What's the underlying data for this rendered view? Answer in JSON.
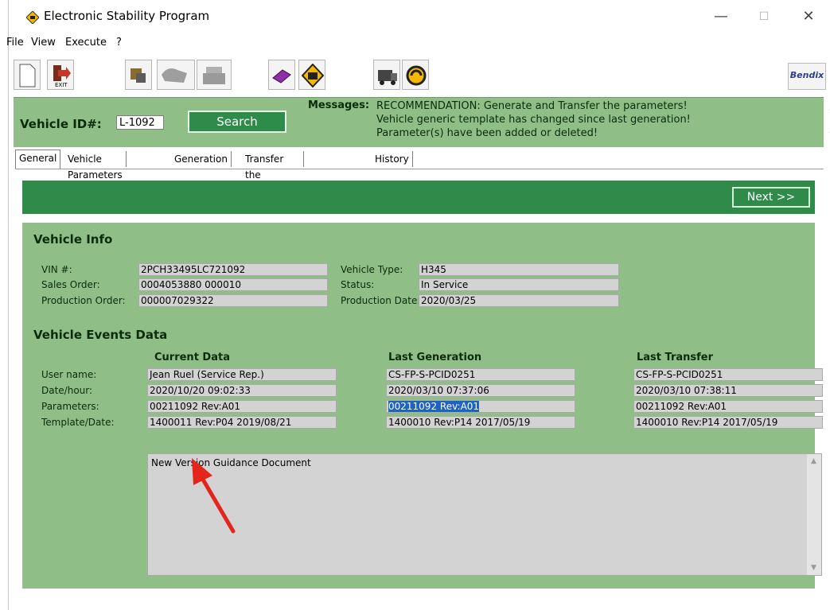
{
  "window": {
    "title": "Electronic Stability Program",
    "controls": {
      "minimize": "—",
      "maximize": "☐",
      "close": "✕"
    }
  },
  "menu": [
    "File",
    "View",
    "Execute",
    "?"
  ],
  "toolbar": {
    "icons": [
      "new-document-icon",
      "exit-icon",
      "vehicle-parts-icon",
      "disabled-truck-icon",
      "disabled-printer-icon",
      "book-icon",
      "esp-logo-icon",
      "truck-icon",
      "refresh-icon"
    ],
    "brand": "Bendix"
  },
  "idbar": {
    "vehicle_id_label": "Vehicle ID#:",
    "vehicle_id_value": "L-1092",
    "search_label": "Search",
    "messages_label": "Messages:",
    "messages": [
      "RECOMMENDATION: Generate and Transfer the  parameters!",
      "Vehicle generic template has changed since last generation!",
      "Parameter(s) have been added or deleted!"
    ]
  },
  "tabs": [
    "General",
    "Vehicle Parameters",
    "Generation",
    "Transfer the Parameters",
    "History"
  ],
  "active_tab": "General",
  "next_label": "Next >>",
  "vehicle_info": {
    "title": "Vehicle Info",
    "vin_label": "VIN #:",
    "vin": "2PCH33495LC721092",
    "sales_order_label": "Sales Order:",
    "sales_order": "0004053880 000010",
    "production_order_label": "Production Order:",
    "production_order": "000007029322",
    "vehicle_type_label": "Vehicle Type:",
    "vehicle_type": "H345",
    "status_label": "Status:",
    "status": "In Service",
    "production_date_label": "Production Date:",
    "production_date": "2020/03/25"
  },
  "events": {
    "title": "Vehicle Events Data",
    "row_labels": [
      "User name:",
      "Date/hour:",
      "Parameters:",
      "Template/Date:"
    ],
    "columns": [
      {
        "header": "Current Data",
        "values": [
          "Jean Ruel (Service Rep.)",
          "2020/10/20 09:02:33",
          "00211092 Rev:A01",
          "1400011 Rev:P04 2019/08/21"
        ]
      },
      {
        "header": "Last Generation",
        "values": [
          "CS-FP-S-PCID0251",
          "2020/03/10 07:37:06",
          "00211092 Rev:A01",
          "1400010 Rev:P14 2017/05/19"
        ]
      },
      {
        "header": "Last Transfer",
        "values": [
          "CS-FP-S-PCID0251",
          "2020/03/10 07:38:11",
          "00211092 Rev:A01",
          "1400010 Rev:P14 2017/05/19"
        ]
      }
    ]
  },
  "notes_text": "New Version Guidance Document",
  "colors": {
    "panel_green": "#8fbf87",
    "dark_green": "#2e8b4a",
    "arrow_red": "#e3251c",
    "selection": "#1e62c8"
  }
}
